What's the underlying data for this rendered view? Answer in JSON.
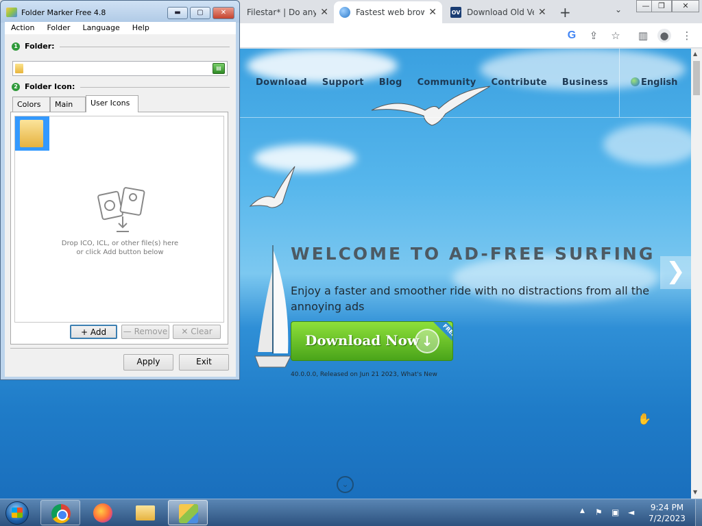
{
  "browser": {
    "tabs": [
      {
        "title": "Filestar* | Do anyt",
        "close": "✕"
      },
      {
        "title": "Fastest web brow",
        "close": "✕"
      },
      {
        "title": "Download Old Ve",
        "close": "✕",
        "favicon_text": "OV"
      }
    ],
    "new_tab": "+",
    "tab_search": "⌄",
    "window_controls": {
      "minimize": "—",
      "restore": "❐",
      "close": "✕"
    },
    "toolbar_icons": {
      "google": "G",
      "share": "⇪",
      "bookmark": "☆",
      "sidepanel": "▥",
      "profile": "●",
      "menu": "⋮"
    }
  },
  "site": {
    "nav": [
      "Download",
      "Support",
      "Blog",
      "Community",
      "Contribute",
      "Business"
    ],
    "language": "English",
    "hero_title": "WELCOME TO AD-FREE SURFING",
    "hero_text": "Enjoy a faster and smoother ride with no distractions from all the annoying ads",
    "download_button": "Download Now",
    "free_badge": "FREE",
    "release_note": "40.0.0.0, Released on Jun 21 2023, What's New",
    "next_arrow": "❯",
    "scroll_down": "⌄"
  },
  "folder_marker": {
    "title": "Folder Marker Free 4.8",
    "title_buttons": {
      "minimize": "▬",
      "maximize": "▢",
      "close": "✕"
    },
    "menu": [
      "Action",
      "Folder",
      "Language",
      "Help"
    ],
    "section_folder": {
      "num": "1",
      "label": "Folder:"
    },
    "folder_value": "",
    "section_icon": {
      "num": "2",
      "label": "Folder Icon:"
    },
    "tabs": [
      "Colors",
      "Main",
      "User Icons"
    ],
    "active_tab": "User Icons",
    "drop_text_1": "Drop ICO, ICL, or other file(s) here",
    "drop_text_2": "or click Add button below",
    "buttons": {
      "add": "Add",
      "remove": "Remove",
      "clear": "Clear",
      "apply": "Apply",
      "exit": "Exit"
    },
    "add_glyph": "+",
    "remove_glyph": "—",
    "clear_glyph": "✕"
  },
  "taskbar": {
    "apps": [
      "Chrome",
      "Firefox",
      "Windows Explorer",
      "Folder Marker"
    ],
    "tray_arrow": "▲",
    "time": "9:24 PM",
    "date": "7/2/2023"
  },
  "colors": {
    "sky": "#56b6ec",
    "download_green": "#6cc22a",
    "nav_text": "#1d3a55",
    "folder_marker_frame": "#bcd4ec",
    "taskbar": "#3a6594"
  }
}
